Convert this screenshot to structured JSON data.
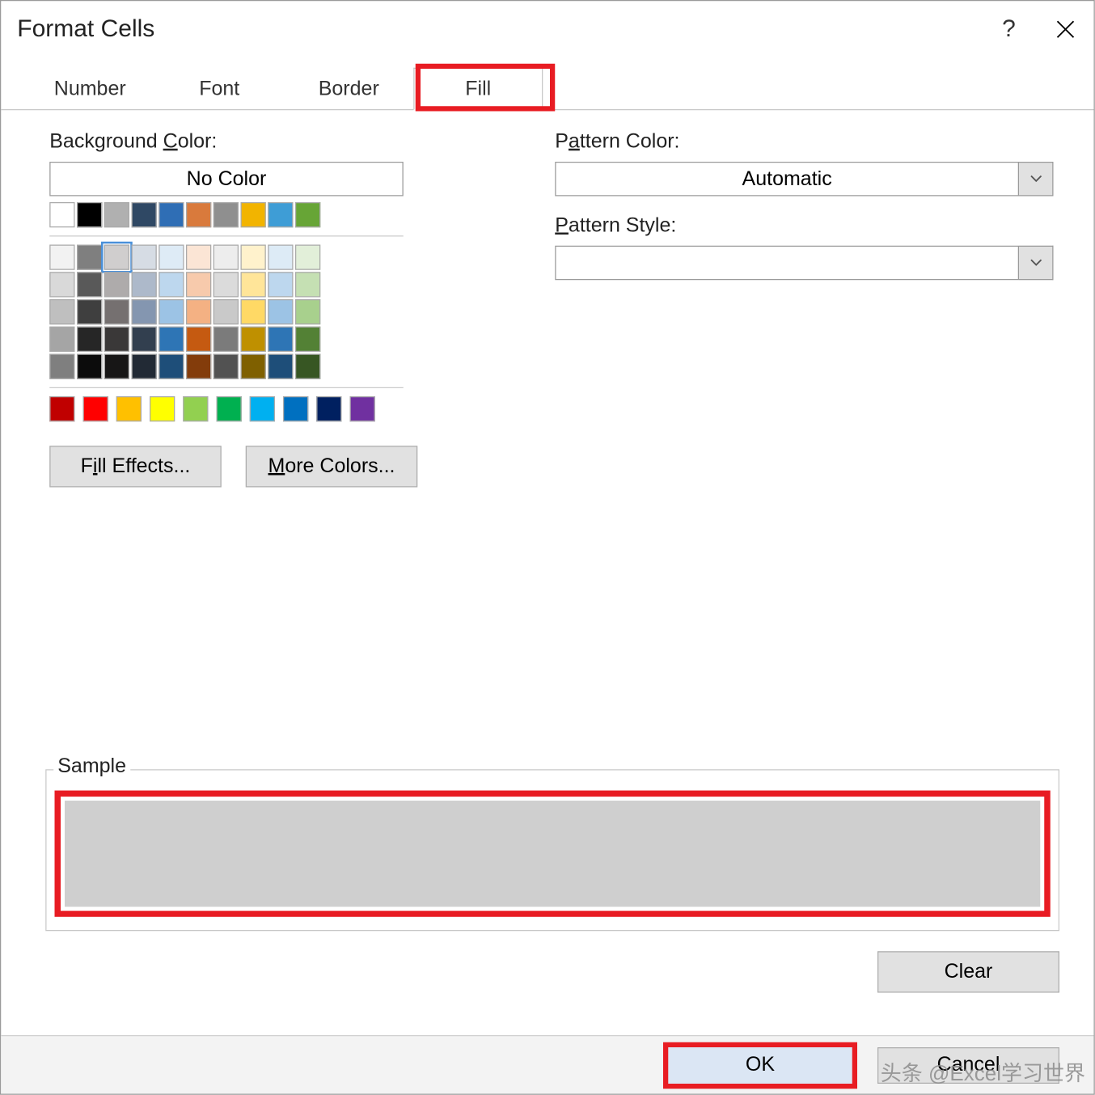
{
  "dialog": {
    "title": "Format Cells",
    "help_tooltip": "?",
    "close_tooltip": "Close"
  },
  "tabs": [
    {
      "label": "Number",
      "active": false
    },
    {
      "label": "Font",
      "active": false
    },
    {
      "label": "Border",
      "active": false
    },
    {
      "label": "Fill",
      "active": true
    }
  ],
  "fill": {
    "bg_label_pre": "Background ",
    "bg_label_u": "C",
    "bg_label_post": "olor:",
    "no_color": "No Color",
    "theme_row1": [
      "#ffffff",
      "#000000",
      "#b0b0b0",
      "#2f4864",
      "#2f6eb5",
      "#d97a3c",
      "#8f8f8f",
      "#f2b400",
      "#3e9dd6",
      "#67a536"
    ],
    "grid": [
      [
        "#f2f2f2",
        "#7f7f7f",
        "#d0cece",
        "#d6dce4",
        "#deebf6",
        "#fbe5d5",
        "#ededed",
        "#fff2cc",
        "#ddebf6",
        "#e2efd9"
      ],
      [
        "#d9d9d9",
        "#595959",
        "#aeabab",
        "#adb9ca",
        "#bdd7ee",
        "#f7caac",
        "#dbdbdb",
        "#ffe599",
        "#bdd7ee",
        "#c5e0b3"
      ],
      [
        "#bfbfbf",
        "#3f3f3f",
        "#757070",
        "#8496b0",
        "#9cc3e5",
        "#f4b183",
        "#c9c9c9",
        "#ffd965",
        "#9cc3e5",
        "#a8d08d"
      ],
      [
        "#a5a5a5",
        "#262626",
        "#3a3838",
        "#323f4f",
        "#2e75b5",
        "#c55a11",
        "#7b7b7b",
        "#bf9000",
        "#2e75b5",
        "#538135"
      ],
      [
        "#7f7f7f",
        "#0c0c0c",
        "#171616",
        "#222a35",
        "#1e4e79",
        "#833c0b",
        "#525252",
        "#7f6000",
        "#1e4e79",
        "#375623"
      ]
    ],
    "standard": [
      "#c00000",
      "#ff0000",
      "#ffc000",
      "#ffff00",
      "#92d050",
      "#00b050",
      "#00b0f0",
      "#0070c0",
      "#002060",
      "#7030a0"
    ],
    "selected_color": "#d0cece",
    "fill_effects_btn_pre": "F",
    "fill_effects_btn_u": "i",
    "fill_effects_btn_post": "ll Effects...",
    "more_colors_btn_pre": "",
    "more_colors_btn_u": "M",
    "more_colors_btn_post": "ore Colors..."
  },
  "pattern": {
    "color_label_pre": "P",
    "color_label_u": "a",
    "color_label_post": "ttern Color:",
    "color_value": "Automatic",
    "style_label_pre": "",
    "style_label_u": "P",
    "style_label_post": "attern Style:",
    "style_value": ""
  },
  "sample": {
    "label": "Sample"
  },
  "buttons": {
    "clear": "Clear",
    "ok": "OK",
    "cancel": "Cancel"
  },
  "watermark": "头条 @Excel学习世界"
}
